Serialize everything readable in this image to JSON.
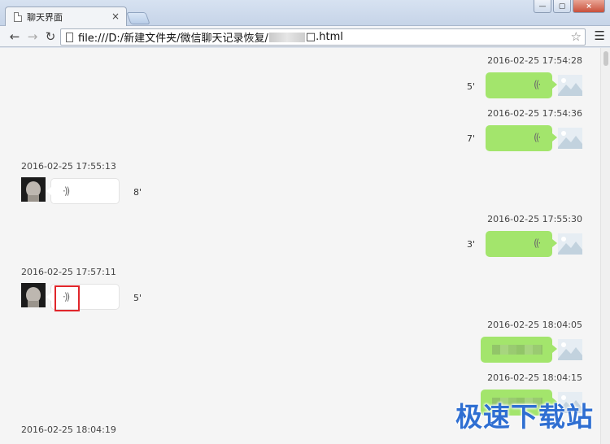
{
  "browser": {
    "tab_title": "聊天界面",
    "tab_close": "×",
    "url_prefix": "file:///D:/新建文件夹/微信聊天记录恢复/",
    "url_suffix": "□.html",
    "window_buttons": [
      "—",
      "▢",
      "×"
    ]
  },
  "messages": [
    {
      "direction": "out",
      "time": "2016-02-25 17:54:28",
      "duration": "5'"
    },
    {
      "direction": "out",
      "time": "2016-02-25 17:54:36",
      "duration": "7'"
    },
    {
      "direction": "in",
      "time": "2016-02-25 17:55:13",
      "duration": "8'"
    },
    {
      "direction": "out",
      "time": "2016-02-25 17:55:30",
      "duration": "3'"
    },
    {
      "direction": "in",
      "time": "2016-02-25 17:57:11",
      "duration": "5'"
    },
    {
      "direction": "out",
      "time": "2016-02-25 18:04:05",
      "duration": ""
    },
    {
      "direction": "out",
      "time": "2016-02-25 18:04:15",
      "duration": ""
    },
    {
      "direction": "in",
      "time": "2016-02-25 18:04:19",
      "duration": ""
    }
  ],
  "voice_glyph": "·))",
  "watermark": "极速下载站",
  "colors": {
    "outgoing_bubble": "#a3e56c",
    "incoming_bubble": "#ffffff",
    "highlight": "#e0262b",
    "watermark": "#2f6fd2"
  }
}
